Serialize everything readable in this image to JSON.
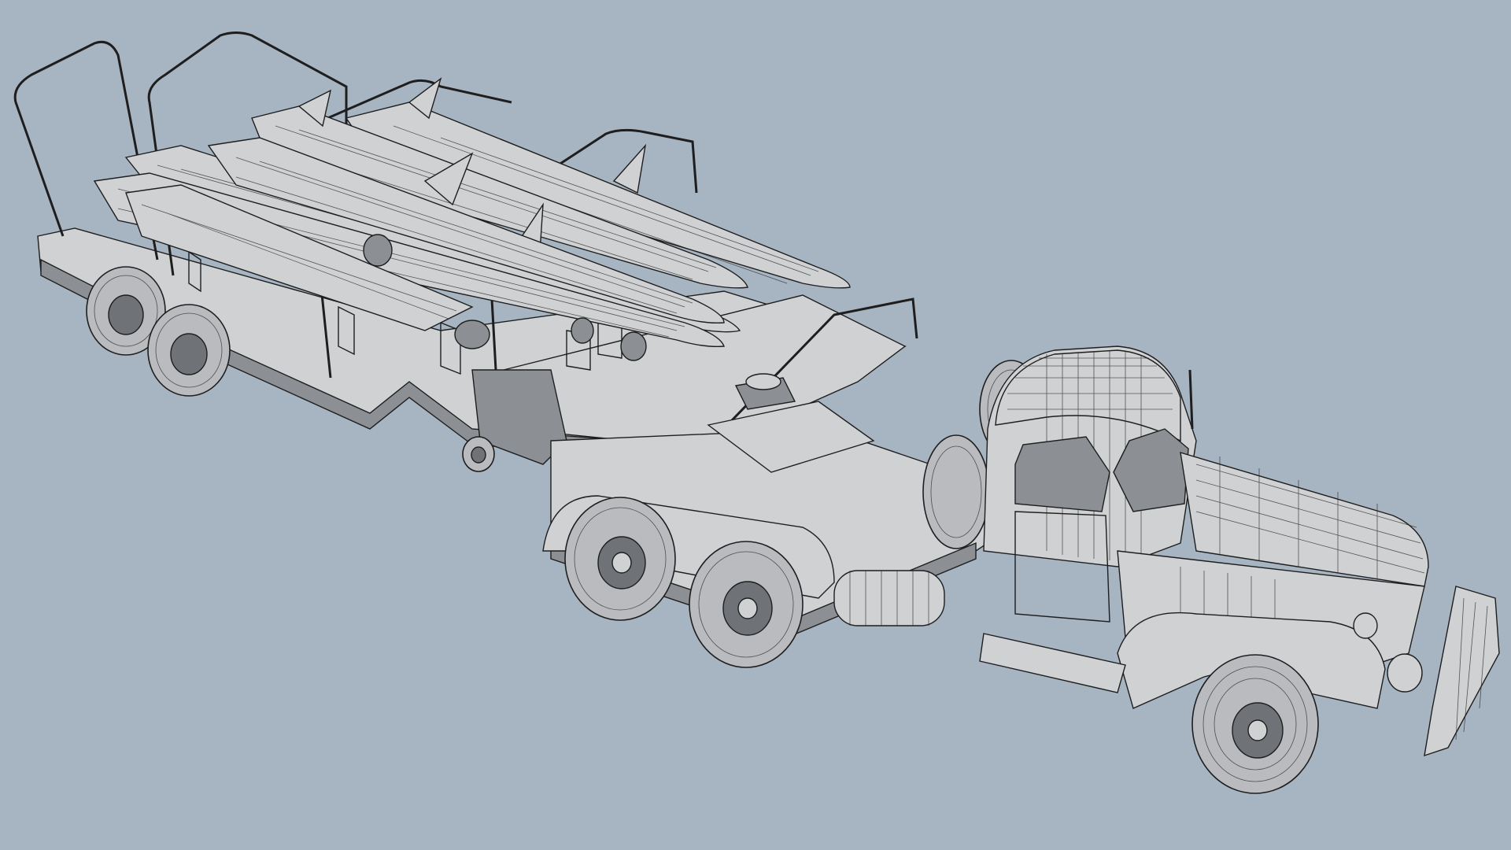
{
  "scene": {
    "background_color": "#a7b4c1",
    "model_fill": "#cfd1d3",
    "wire_color": "#1e1e1e",
    "render_mode": "wireframe-shaded"
  }
}
